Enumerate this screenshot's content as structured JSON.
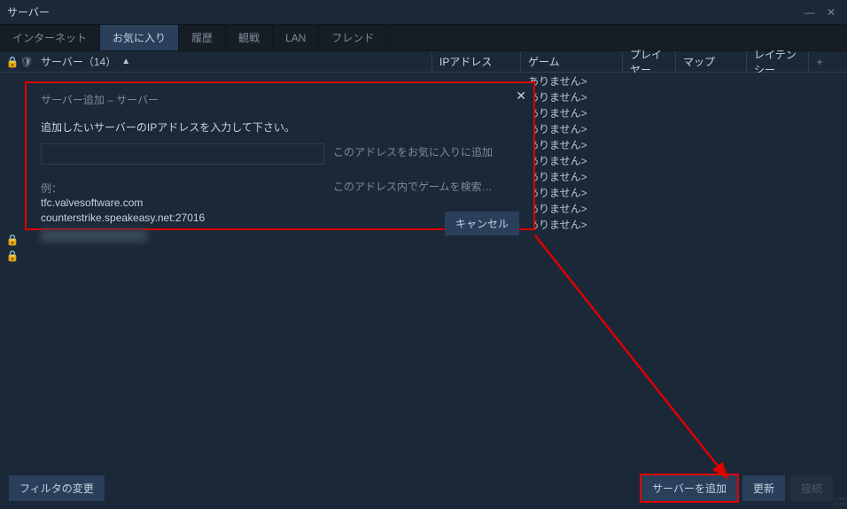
{
  "window": {
    "title": "サーバー"
  },
  "tabs": {
    "internet": "インターネット",
    "favorites": "お気に入り",
    "history": "履歴",
    "spectate": "観戦",
    "lan": "LAN",
    "friend": "フレンド"
  },
  "columns": {
    "server": "サーバー（14）",
    "ip": "IPアドレス",
    "game": "ゲーム",
    "player": "プレイヤー",
    "map": "マップ",
    "latency": "レイテンシー"
  },
  "sort_arrow": "▲",
  "plus": "+",
  "noresponse": "ありません>",
  "footer": {
    "filter": "フィルタの変更",
    "addserver": "サーバーを追加",
    "refresh": "更新",
    "connect": "接続"
  },
  "dialog": {
    "title": "サーバー追加 – サーバー",
    "prompt": "追加したいサーバーのIPアドレスを入力して下さい。",
    "add_fav": "このアドレスをお気に入りに追加",
    "find_games": "このアドレス内でゲームを検索…",
    "example_label": "例：",
    "example1": "tfc.valvesoftware.com",
    "example2": "counterstrike.speakeasy.net:27016",
    "cancel": "キャンセル",
    "close": "✕"
  },
  "winbtns": {
    "min": "—",
    "close": "✕"
  },
  "grip": ".::"
}
